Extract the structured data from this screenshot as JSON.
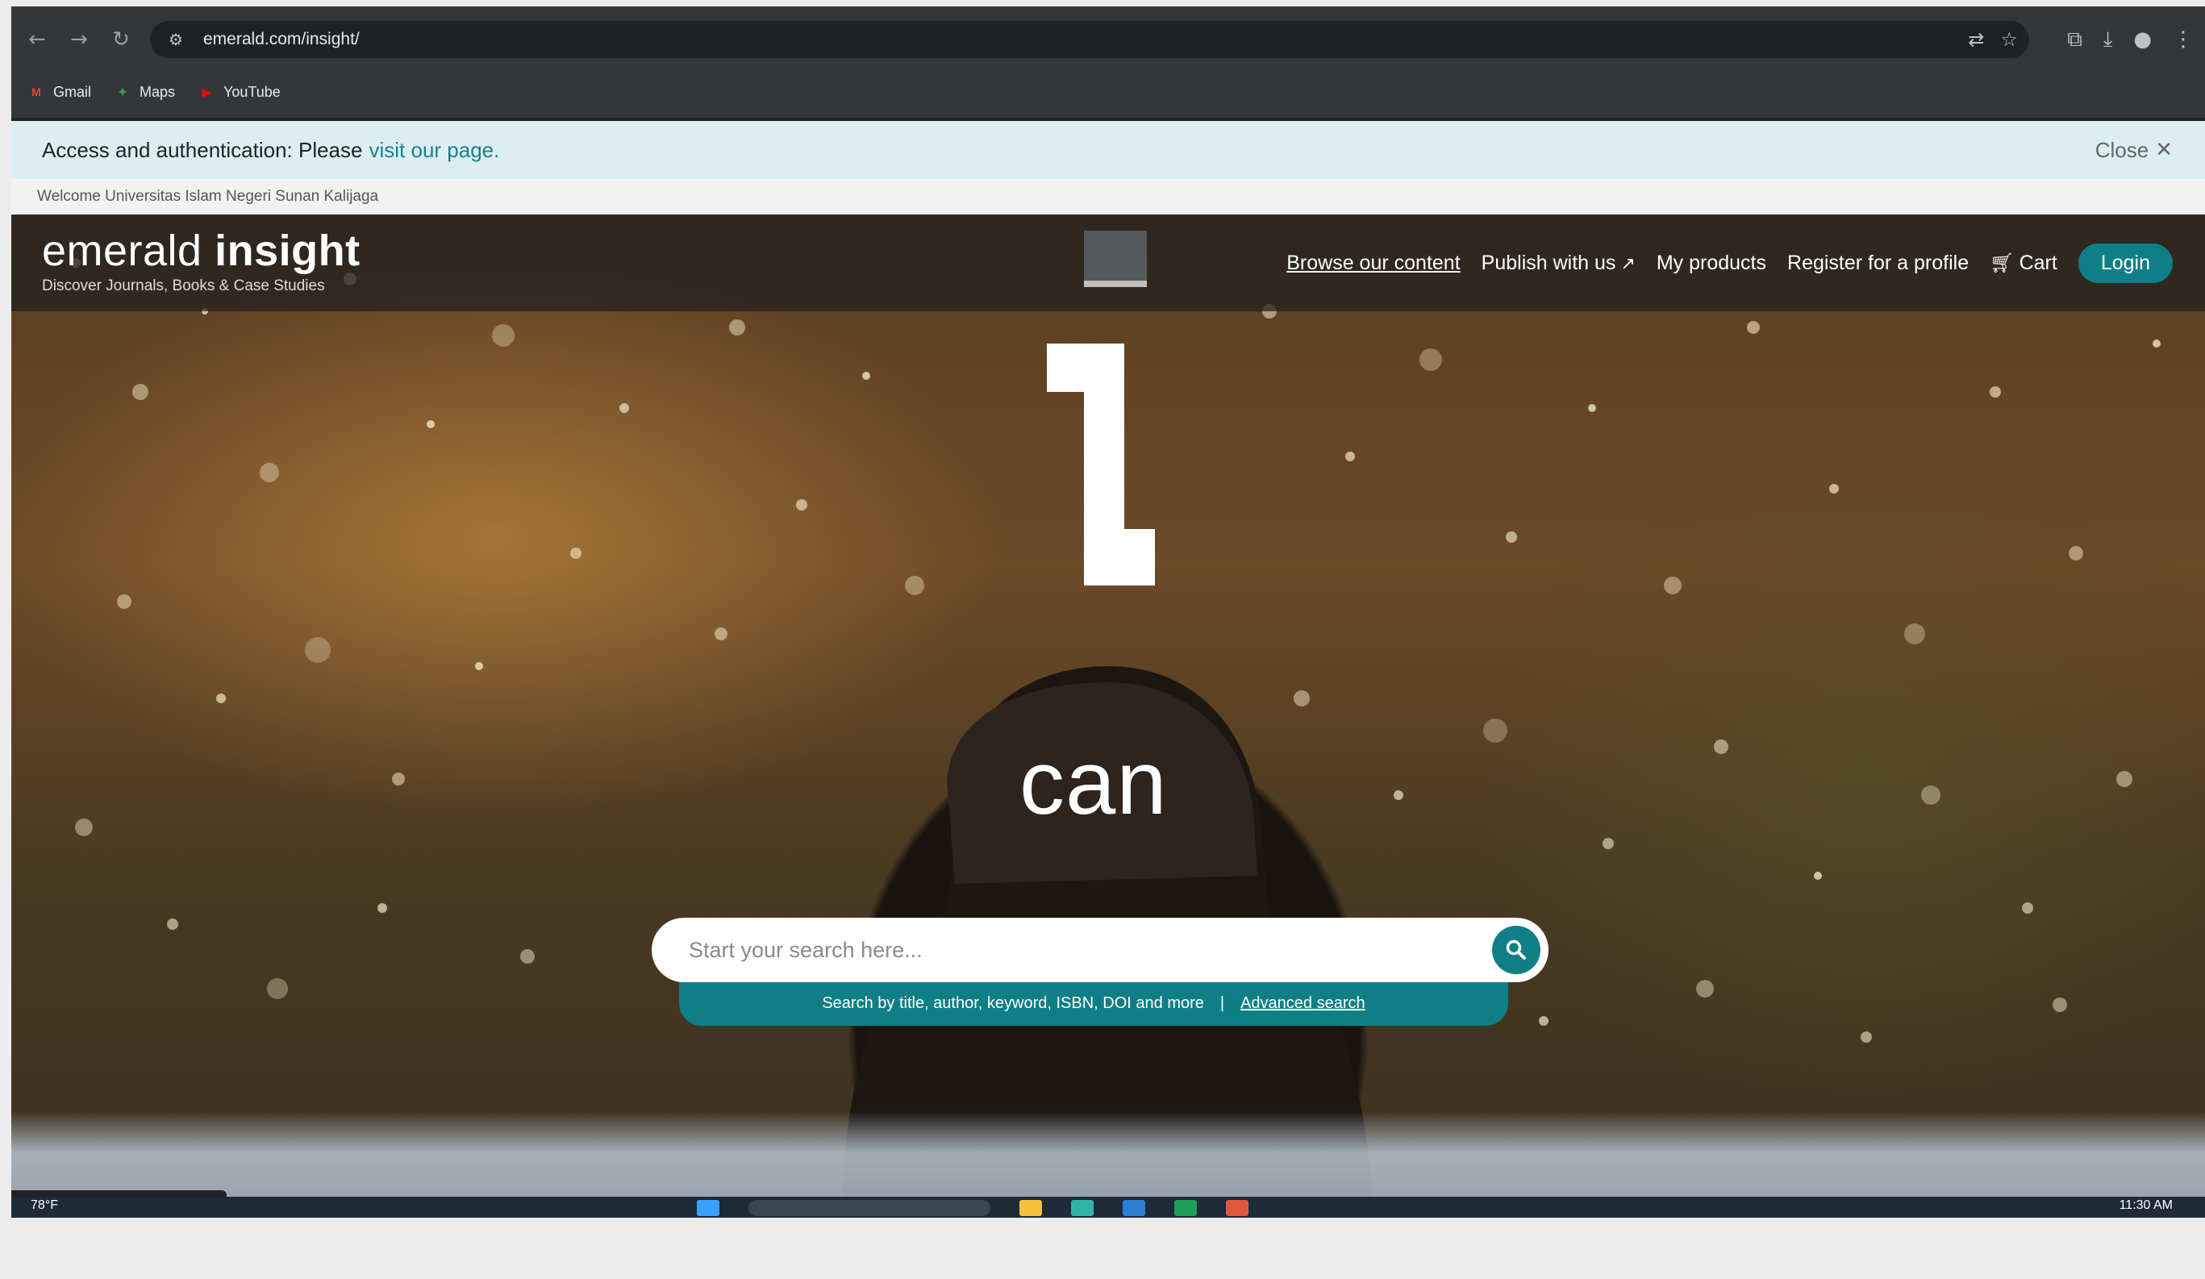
{
  "browser": {
    "url": "emerald.com/insight/",
    "bookmarks": [
      {
        "label": "Gmail",
        "icon": "gmail-icon",
        "color": "#ea4335"
      },
      {
        "label": "Maps",
        "icon": "maps-icon",
        "color": "#34a853"
      },
      {
        "label": "YouTube",
        "icon": "youtube-icon",
        "color": "#ff0000"
      }
    ],
    "status_url": "https://www.emerald.com/insight/#"
  },
  "banner": {
    "label": "Access and authentication: Please",
    "link": "visit our page.",
    "close": "Close"
  },
  "welcome": "Welcome Universitas Islam Negeri Sunan Kalijaga",
  "header": {
    "logo_light": "emerald ",
    "logo_bold": "insight",
    "tagline": "Discover Journals, Books & Case Studies",
    "nav": {
      "browse": "Browse our content",
      "publish": "Publish with us",
      "products": "My products",
      "register": "Register for a profile",
      "cart": "Cart",
      "login": "Login"
    }
  },
  "hero": {
    "word": "can"
  },
  "search": {
    "placeholder": "Start your search here...",
    "hint": "Search by title, author, keyword, ISBN, DOI and more",
    "separator": "|",
    "advanced": "Advanced search"
  },
  "taskbar": {
    "weather": "78°F",
    "clock": "11:30 AM"
  },
  "colors": {
    "brand_teal": "#0f7f86",
    "banner_bg": "#dbeff3"
  }
}
